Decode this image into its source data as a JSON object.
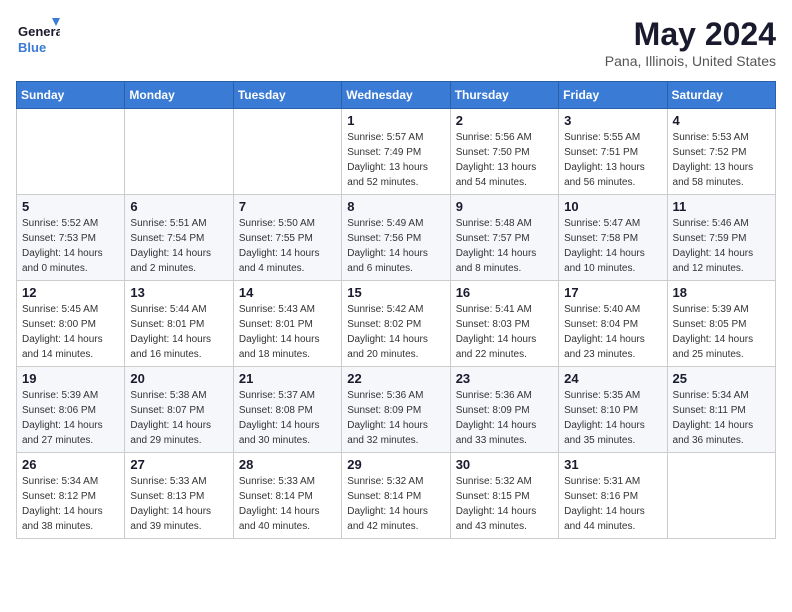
{
  "logo": {
    "line1": "General",
    "line2": "Blue"
  },
  "title": "May 2024",
  "location": "Pana, Illinois, United States",
  "weekdays": [
    "Sunday",
    "Monday",
    "Tuesday",
    "Wednesday",
    "Thursday",
    "Friday",
    "Saturday"
  ],
  "weeks": [
    [
      {
        "day": "",
        "sunrise": "",
        "sunset": "",
        "daylight": ""
      },
      {
        "day": "",
        "sunrise": "",
        "sunset": "",
        "daylight": ""
      },
      {
        "day": "",
        "sunrise": "",
        "sunset": "",
        "daylight": ""
      },
      {
        "day": "1",
        "sunrise": "Sunrise: 5:57 AM",
        "sunset": "Sunset: 7:49 PM",
        "daylight": "Daylight: 13 hours and 52 minutes."
      },
      {
        "day": "2",
        "sunrise": "Sunrise: 5:56 AM",
        "sunset": "Sunset: 7:50 PM",
        "daylight": "Daylight: 13 hours and 54 minutes."
      },
      {
        "day": "3",
        "sunrise": "Sunrise: 5:55 AM",
        "sunset": "Sunset: 7:51 PM",
        "daylight": "Daylight: 13 hours and 56 minutes."
      },
      {
        "day": "4",
        "sunrise": "Sunrise: 5:53 AM",
        "sunset": "Sunset: 7:52 PM",
        "daylight": "Daylight: 13 hours and 58 minutes."
      }
    ],
    [
      {
        "day": "5",
        "sunrise": "Sunrise: 5:52 AM",
        "sunset": "Sunset: 7:53 PM",
        "daylight": "Daylight: 14 hours and 0 minutes."
      },
      {
        "day": "6",
        "sunrise": "Sunrise: 5:51 AM",
        "sunset": "Sunset: 7:54 PM",
        "daylight": "Daylight: 14 hours and 2 minutes."
      },
      {
        "day": "7",
        "sunrise": "Sunrise: 5:50 AM",
        "sunset": "Sunset: 7:55 PM",
        "daylight": "Daylight: 14 hours and 4 minutes."
      },
      {
        "day": "8",
        "sunrise": "Sunrise: 5:49 AM",
        "sunset": "Sunset: 7:56 PM",
        "daylight": "Daylight: 14 hours and 6 minutes."
      },
      {
        "day": "9",
        "sunrise": "Sunrise: 5:48 AM",
        "sunset": "Sunset: 7:57 PM",
        "daylight": "Daylight: 14 hours and 8 minutes."
      },
      {
        "day": "10",
        "sunrise": "Sunrise: 5:47 AM",
        "sunset": "Sunset: 7:58 PM",
        "daylight": "Daylight: 14 hours and 10 minutes."
      },
      {
        "day": "11",
        "sunrise": "Sunrise: 5:46 AM",
        "sunset": "Sunset: 7:59 PM",
        "daylight": "Daylight: 14 hours and 12 minutes."
      }
    ],
    [
      {
        "day": "12",
        "sunrise": "Sunrise: 5:45 AM",
        "sunset": "Sunset: 8:00 PM",
        "daylight": "Daylight: 14 hours and 14 minutes."
      },
      {
        "day": "13",
        "sunrise": "Sunrise: 5:44 AM",
        "sunset": "Sunset: 8:01 PM",
        "daylight": "Daylight: 14 hours and 16 minutes."
      },
      {
        "day": "14",
        "sunrise": "Sunrise: 5:43 AM",
        "sunset": "Sunset: 8:01 PM",
        "daylight": "Daylight: 14 hours and 18 minutes."
      },
      {
        "day": "15",
        "sunrise": "Sunrise: 5:42 AM",
        "sunset": "Sunset: 8:02 PM",
        "daylight": "Daylight: 14 hours and 20 minutes."
      },
      {
        "day": "16",
        "sunrise": "Sunrise: 5:41 AM",
        "sunset": "Sunset: 8:03 PM",
        "daylight": "Daylight: 14 hours and 22 minutes."
      },
      {
        "day": "17",
        "sunrise": "Sunrise: 5:40 AM",
        "sunset": "Sunset: 8:04 PM",
        "daylight": "Daylight: 14 hours and 23 minutes."
      },
      {
        "day": "18",
        "sunrise": "Sunrise: 5:39 AM",
        "sunset": "Sunset: 8:05 PM",
        "daylight": "Daylight: 14 hours and 25 minutes."
      }
    ],
    [
      {
        "day": "19",
        "sunrise": "Sunrise: 5:39 AM",
        "sunset": "Sunset: 8:06 PM",
        "daylight": "Daylight: 14 hours and 27 minutes."
      },
      {
        "day": "20",
        "sunrise": "Sunrise: 5:38 AM",
        "sunset": "Sunset: 8:07 PM",
        "daylight": "Daylight: 14 hours and 29 minutes."
      },
      {
        "day": "21",
        "sunrise": "Sunrise: 5:37 AM",
        "sunset": "Sunset: 8:08 PM",
        "daylight": "Daylight: 14 hours and 30 minutes."
      },
      {
        "day": "22",
        "sunrise": "Sunrise: 5:36 AM",
        "sunset": "Sunset: 8:09 PM",
        "daylight": "Daylight: 14 hours and 32 minutes."
      },
      {
        "day": "23",
        "sunrise": "Sunrise: 5:36 AM",
        "sunset": "Sunset: 8:09 PM",
        "daylight": "Daylight: 14 hours and 33 minutes."
      },
      {
        "day": "24",
        "sunrise": "Sunrise: 5:35 AM",
        "sunset": "Sunset: 8:10 PM",
        "daylight": "Daylight: 14 hours and 35 minutes."
      },
      {
        "day": "25",
        "sunrise": "Sunrise: 5:34 AM",
        "sunset": "Sunset: 8:11 PM",
        "daylight": "Daylight: 14 hours and 36 minutes."
      }
    ],
    [
      {
        "day": "26",
        "sunrise": "Sunrise: 5:34 AM",
        "sunset": "Sunset: 8:12 PM",
        "daylight": "Daylight: 14 hours and 38 minutes."
      },
      {
        "day": "27",
        "sunrise": "Sunrise: 5:33 AM",
        "sunset": "Sunset: 8:13 PM",
        "daylight": "Daylight: 14 hours and 39 minutes."
      },
      {
        "day": "28",
        "sunrise": "Sunrise: 5:33 AM",
        "sunset": "Sunset: 8:14 PM",
        "daylight": "Daylight: 14 hours and 40 minutes."
      },
      {
        "day": "29",
        "sunrise": "Sunrise: 5:32 AM",
        "sunset": "Sunset: 8:14 PM",
        "daylight": "Daylight: 14 hours and 42 minutes."
      },
      {
        "day": "30",
        "sunrise": "Sunrise: 5:32 AM",
        "sunset": "Sunset: 8:15 PM",
        "daylight": "Daylight: 14 hours and 43 minutes."
      },
      {
        "day": "31",
        "sunrise": "Sunrise: 5:31 AM",
        "sunset": "Sunset: 8:16 PM",
        "daylight": "Daylight: 14 hours and 44 minutes."
      },
      {
        "day": "",
        "sunrise": "",
        "sunset": "",
        "daylight": ""
      }
    ]
  ]
}
